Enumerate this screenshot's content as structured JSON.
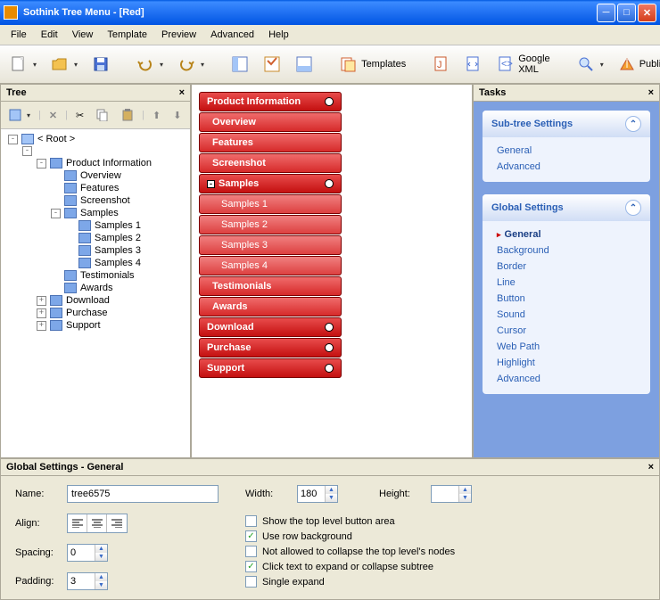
{
  "title": "Sothink Tree Menu - [Red]",
  "menubar": [
    "File",
    "Edit",
    "View",
    "Template",
    "Preview",
    "Advanced",
    "Help"
  ],
  "toolbar": {
    "templates": "Templates",
    "googleXml": "Google XML",
    "publish": "Publish"
  },
  "treePanel": {
    "title": "Tree",
    "nodes": [
      {
        "level": 0,
        "exp": "-",
        "icon": "root",
        "label": "< Root >"
      },
      {
        "level": 1,
        "exp": "-",
        "icon": "",
        "label": ""
      },
      {
        "level": 2,
        "exp": "-",
        "icon": "node",
        "label": "Product Information"
      },
      {
        "level": 3,
        "exp": "",
        "icon": "node",
        "label": "Overview"
      },
      {
        "level": 3,
        "exp": "",
        "icon": "node",
        "label": "Features"
      },
      {
        "level": 3,
        "exp": "",
        "icon": "node",
        "label": "Screenshot"
      },
      {
        "level": 3,
        "exp": "-",
        "icon": "node",
        "label": "Samples"
      },
      {
        "level": 4,
        "exp": "",
        "icon": "node",
        "label": "Samples 1"
      },
      {
        "level": 4,
        "exp": "",
        "icon": "node",
        "label": "Samples 2"
      },
      {
        "level": 4,
        "exp": "",
        "icon": "node",
        "label": "Samples 3"
      },
      {
        "level": 4,
        "exp": "",
        "icon": "node",
        "label": "Samples 4"
      },
      {
        "level": 3,
        "exp": "",
        "icon": "node",
        "label": "Testimonials"
      },
      {
        "level": 3,
        "exp": "",
        "icon": "node",
        "label": "Awards"
      },
      {
        "level": 2,
        "exp": "+",
        "icon": "node",
        "label": "Download"
      },
      {
        "level": 2,
        "exp": "+",
        "icon": "node",
        "label": "Purchase"
      },
      {
        "level": 2,
        "exp": "+",
        "icon": "node",
        "label": "Support"
      }
    ]
  },
  "preview": [
    {
      "type": "top",
      "label": "Product Information",
      "bullet": true
    },
    {
      "type": "sub",
      "label": "Overview"
    },
    {
      "type": "sub",
      "label": "Features"
    },
    {
      "type": "sub",
      "label": "Screenshot"
    },
    {
      "type": "top",
      "label": "Samples",
      "bullet": true,
      "exp": "-"
    },
    {
      "type": "sub2",
      "label": "Samples 1"
    },
    {
      "type": "sub2",
      "label": "Samples 2"
    },
    {
      "type": "sub2",
      "label": "Samples 3"
    },
    {
      "type": "sub2",
      "label": "Samples 4"
    },
    {
      "type": "sub",
      "label": "Testimonials"
    },
    {
      "type": "sub",
      "label": "Awards"
    },
    {
      "type": "top",
      "label": "Download",
      "bullet": true
    },
    {
      "type": "top",
      "label": "Purchase",
      "bullet": true
    },
    {
      "type": "top",
      "label": "Support",
      "bullet": true
    }
  ],
  "tasksPanel": {
    "title": "Tasks",
    "groups": [
      {
        "title": "Sub-tree Settings",
        "items": [
          {
            "label": "General"
          },
          {
            "label": "Advanced"
          }
        ]
      },
      {
        "title": "Global Settings",
        "items": [
          {
            "label": "General",
            "active": true
          },
          {
            "label": "Background"
          },
          {
            "label": "Border"
          },
          {
            "label": "Line"
          },
          {
            "label": "Button"
          },
          {
            "label": "Sound"
          },
          {
            "label": "Cursor"
          },
          {
            "label": "Web Path"
          },
          {
            "label": "Highlight"
          },
          {
            "label": "Advanced"
          }
        ]
      }
    ]
  },
  "settings": {
    "title": "Global Settings - General",
    "labels": {
      "name": "Name:",
      "width": "Width:",
      "height": "Height:",
      "align": "Align:",
      "spacing": "Spacing:",
      "padding": "Padding:"
    },
    "values": {
      "name": "tree6575",
      "width": "180",
      "height": "",
      "spacing": "0",
      "padding": "3"
    },
    "checkboxes": [
      {
        "label": "Show the top level button area",
        "checked": false
      },
      {
        "label": "Use row background",
        "checked": true
      },
      {
        "label": "Not allowed to collapse the top level's nodes",
        "checked": false
      },
      {
        "label": "Click text to expand or collapse subtree",
        "checked": true
      },
      {
        "label": "Single expand",
        "checked": false
      }
    ]
  }
}
